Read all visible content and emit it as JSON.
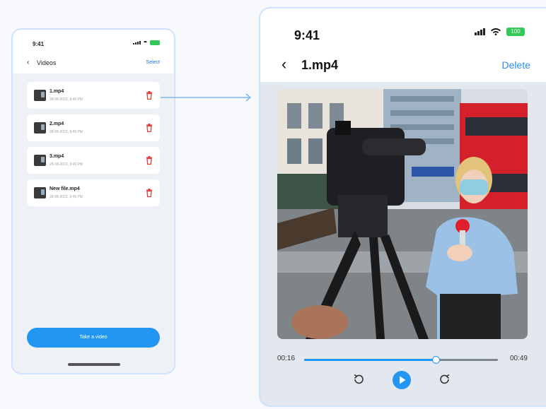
{
  "colors": {
    "accent": "#2196f3",
    "battery": "#34c759",
    "delete_icon": "#e53935"
  },
  "list_screen": {
    "status_time": "9:41",
    "back_icon": "chevron-left-icon",
    "title": "Videos",
    "select_label": "Select",
    "items": [
      {
        "name": "1.mp4",
        "date": "28-08-2023, 9:49 PM"
      },
      {
        "name": "2.mp4",
        "date": "28-08-2023, 9:49 PM"
      },
      {
        "name": "3.mp4",
        "date": "28-08-2023, 9:49 PM"
      },
      {
        "name": "New file.mp4",
        "date": "28-08-2023, 9:49 PM"
      }
    ],
    "cta_label": "Take a video"
  },
  "player_screen": {
    "status_time": "9:41",
    "battery_label": "100",
    "back_icon": "chevron-left-icon",
    "title": "1.mp4",
    "delete_label": "Delete",
    "video_icon": "video-frame-reporter",
    "time_elapsed": "00:16",
    "time_total": "00:49",
    "progress": 0.68,
    "controls": [
      "rewind-icon",
      "play-icon",
      "forward-icon"
    ]
  }
}
